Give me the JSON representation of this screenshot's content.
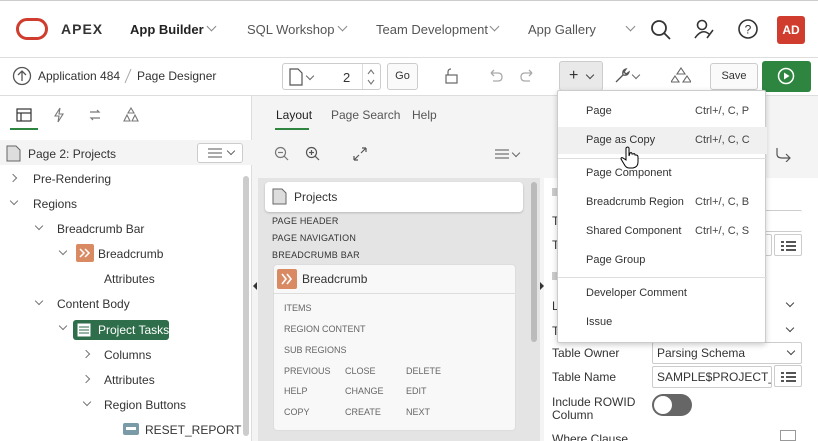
{
  "nav": {
    "app_name": "APEX",
    "items": [
      {
        "label": "App Builder",
        "active": true
      },
      {
        "label": "SQL Workshop",
        "active": false
      },
      {
        "label": "Team Development",
        "active": false
      },
      {
        "label": "App Gallery",
        "active": false
      }
    ],
    "avatar": "AD"
  },
  "toolbar": {
    "app_crumb": "Application 484",
    "page_crumb": "Page Designer",
    "page_number": "2",
    "go_label": "Go",
    "save_label": "Save"
  },
  "left": {
    "page_title": "Page 2: Projects",
    "tree": {
      "pre_rendering": "Pre-Rendering",
      "regions": "Regions",
      "breadcrumb_bar": "Breadcrumb Bar",
      "breadcrumb": "Breadcrumb",
      "attributes1": "Attributes",
      "content_body": "Content Body",
      "project_tasks": "Project Tasks",
      "columns": "Columns",
      "attributes2": "Attributes",
      "region_buttons": "Region Buttons",
      "reset_report": "RESET_REPORT"
    }
  },
  "middle": {
    "tabs": [
      "Layout",
      "Page Search",
      "Help"
    ],
    "projects": "Projects",
    "positions": [
      "PAGE HEADER",
      "PAGE NAVIGATION",
      "BREADCRUMB BAR"
    ],
    "breadcrumb_region": "Breadcrumb",
    "slots": {
      "items": "ITEMS",
      "region_content": "REGION CONTENT",
      "sub_regions": "SUB REGIONS",
      "previous": "PREVIOUS",
      "close": "CLOSE",
      "delete": "DELETE",
      "help": "HELP",
      "change": "CHANGE",
      "edit": "EDIT",
      "copy": "COPY",
      "create": "CREATE",
      "next": "NEXT"
    }
  },
  "right": {
    "table_owner_label": "Table Owner",
    "table_owner_value": "Parsing Schema",
    "table_name_label": "Table Name",
    "table_name_value": "SAMPLE$PROJECT_TA",
    "include_rowid_label": "Include ROWID",
    "include_rowid_label2": "Column",
    "include_rowid_on": false,
    "where_clause_label": "Where Clause",
    "partial_l": "L",
    "partial_t": "T",
    "partial_t2": "T",
    "partial_t3": "T"
  },
  "menu": {
    "items": [
      {
        "label": "Page",
        "shortcut": "Ctrl+/, C, P"
      },
      {
        "label": "Page as Copy",
        "shortcut": "Ctrl+/, C, C"
      },
      {
        "label": "Page Component",
        "shortcut": ""
      },
      {
        "label": "Breadcrumb Region",
        "shortcut": "Ctrl+/, C, B"
      },
      {
        "label": "Shared Component",
        "shortcut": "Ctrl+/, C, S"
      },
      {
        "label": "Page Group",
        "shortcut": ""
      },
      {
        "label": "Developer Comment",
        "shortcut": ""
      },
      {
        "label": "Issue",
        "shortcut": ""
      }
    ]
  },
  "colors": {
    "brand_red": "#d03d2e",
    "run_green": "#2e8540",
    "selected_row": "#2e6e4a"
  }
}
